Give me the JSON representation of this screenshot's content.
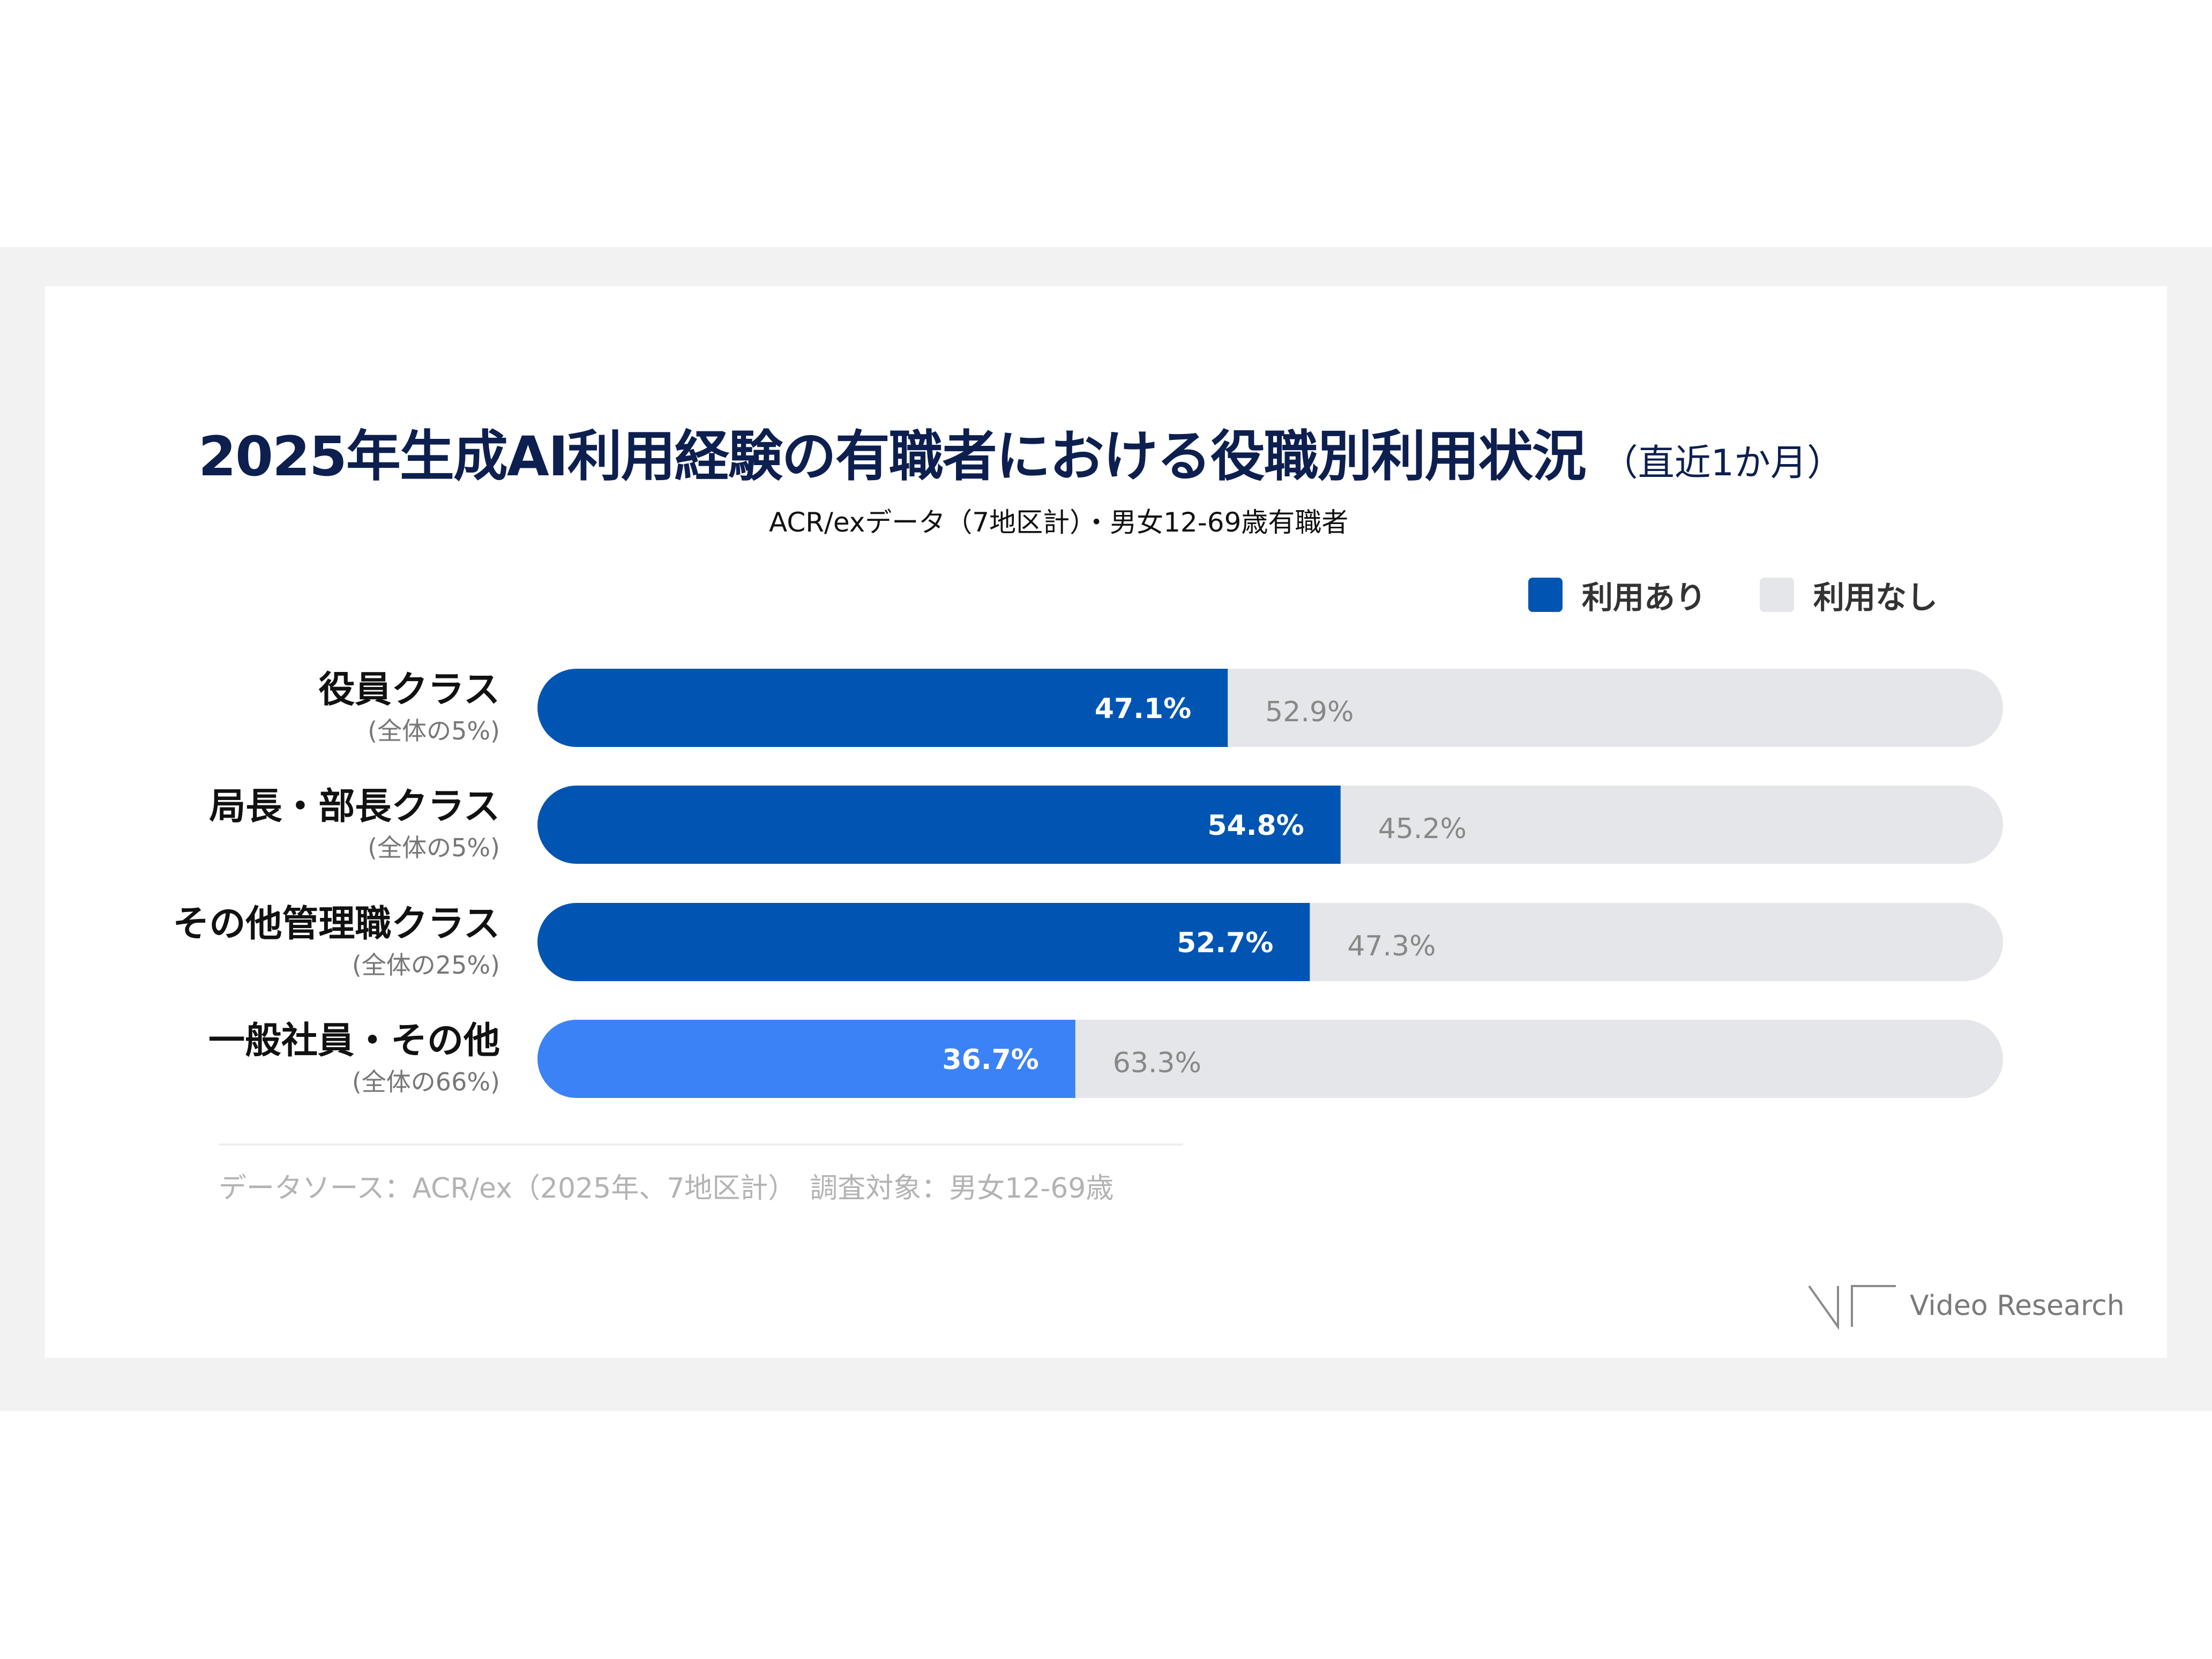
{
  "chart_data": {
    "type": "bar",
    "orientation": "horizontal",
    "stacked": true,
    "title": "2025年生成AI利用経験の有職者における役職別利用状況",
    "title_suffix": "（直近1か月）",
    "subtitle": "ACR/exデータ（7地区計）・男女12‐69歳有職者",
    "categories": [
      "役員クラス",
      "局長・部長クラス",
      "その他管理職クラス",
      "一般社員・その他"
    ],
    "category_notes": [
      "(全体の5%)",
      "(全体の5%)",
      "(全体の25%)",
      "(全体の66%)"
    ],
    "series": [
      {
        "name": "利用あり",
        "values": [
          47.1,
          54.8,
          52.7,
          36.7
        ],
        "labels": [
          "47.1%",
          "54.8%",
          "52.7%",
          "36.7%"
        ]
      },
      {
        "name": "利用なし",
        "values": [
          52.9,
          45.2,
          47.3,
          63.3
        ],
        "labels": [
          "52.9%",
          "45.2%",
          "47.3%",
          "63.3%"
        ]
      }
    ],
    "xlim": [
      0,
      100
    ],
    "legend_position": "top-right",
    "grid": false,
    "colors": {
      "used": "#0055b3",
      "used_highlight": "#3b82f6",
      "not_used": "#e5e6ea",
      "used_label": "#ffffff",
      "not_used_label": "#888888",
      "category": "#111111",
      "category_note": "#777777"
    },
    "highlight_category_index": 3
  },
  "footer": {
    "source": "データソース：ACR/ex（2025年、7地区計）　調査対象：男女12-69歳"
  },
  "logo": {
    "text": "Video Research",
    "icon": "video-research-logo-icon"
  }
}
